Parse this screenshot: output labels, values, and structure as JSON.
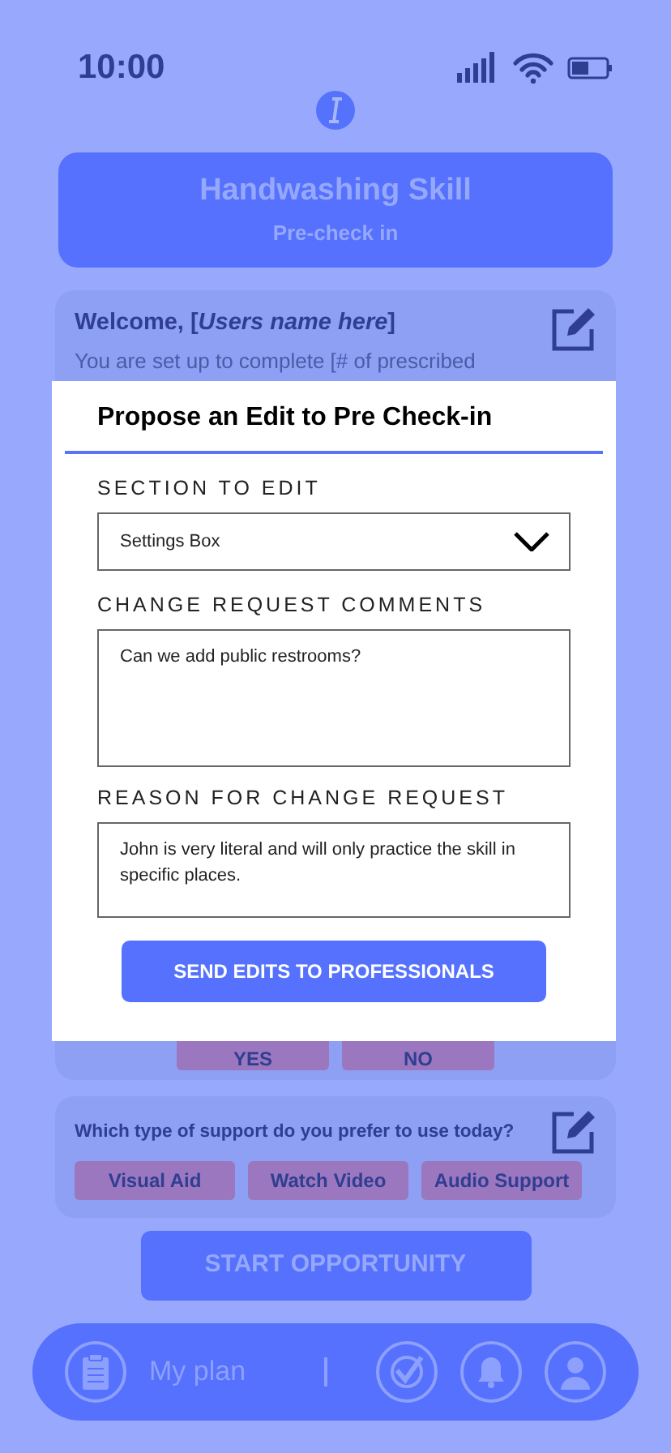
{
  "status_bar": {
    "time": "10:00"
  },
  "header": {
    "title": "Handwashing Skill",
    "subtitle": "Pre-check in"
  },
  "welcome_card": {
    "title": "Welcome, [*Users name here*]",
    "text": "You are set up to complete [# of prescribed",
    "answers": [
      "YES",
      "NO"
    ]
  },
  "modal": {
    "title": "Propose an Edit to Pre Check-in",
    "fields": [
      {
        "kind": "select",
        "label": "SECTION TO EDIT",
        "value": "Settings Box"
      },
      {
        "kind": "textarea",
        "label": "CHANGE REQUEST COMMENTS",
        "value": "Can we add public restrooms?"
      },
      {
        "kind": "textarea",
        "label": "REASON FOR CHANGE REQUEST",
        "value": "John is very literal and will only practice the skill in specific places."
      }
    ],
    "button": "SEND EDITS TO PROFESSIONALS"
  },
  "support_card": {
    "question": "Which type of support do you prefer to use today?",
    "options": [
      "Visual Aid",
      "Watch Video",
      "Audio Support"
    ]
  },
  "start_button": "START OPPORTUNITY",
  "bottom_nav": {
    "label": "My plan"
  }
}
